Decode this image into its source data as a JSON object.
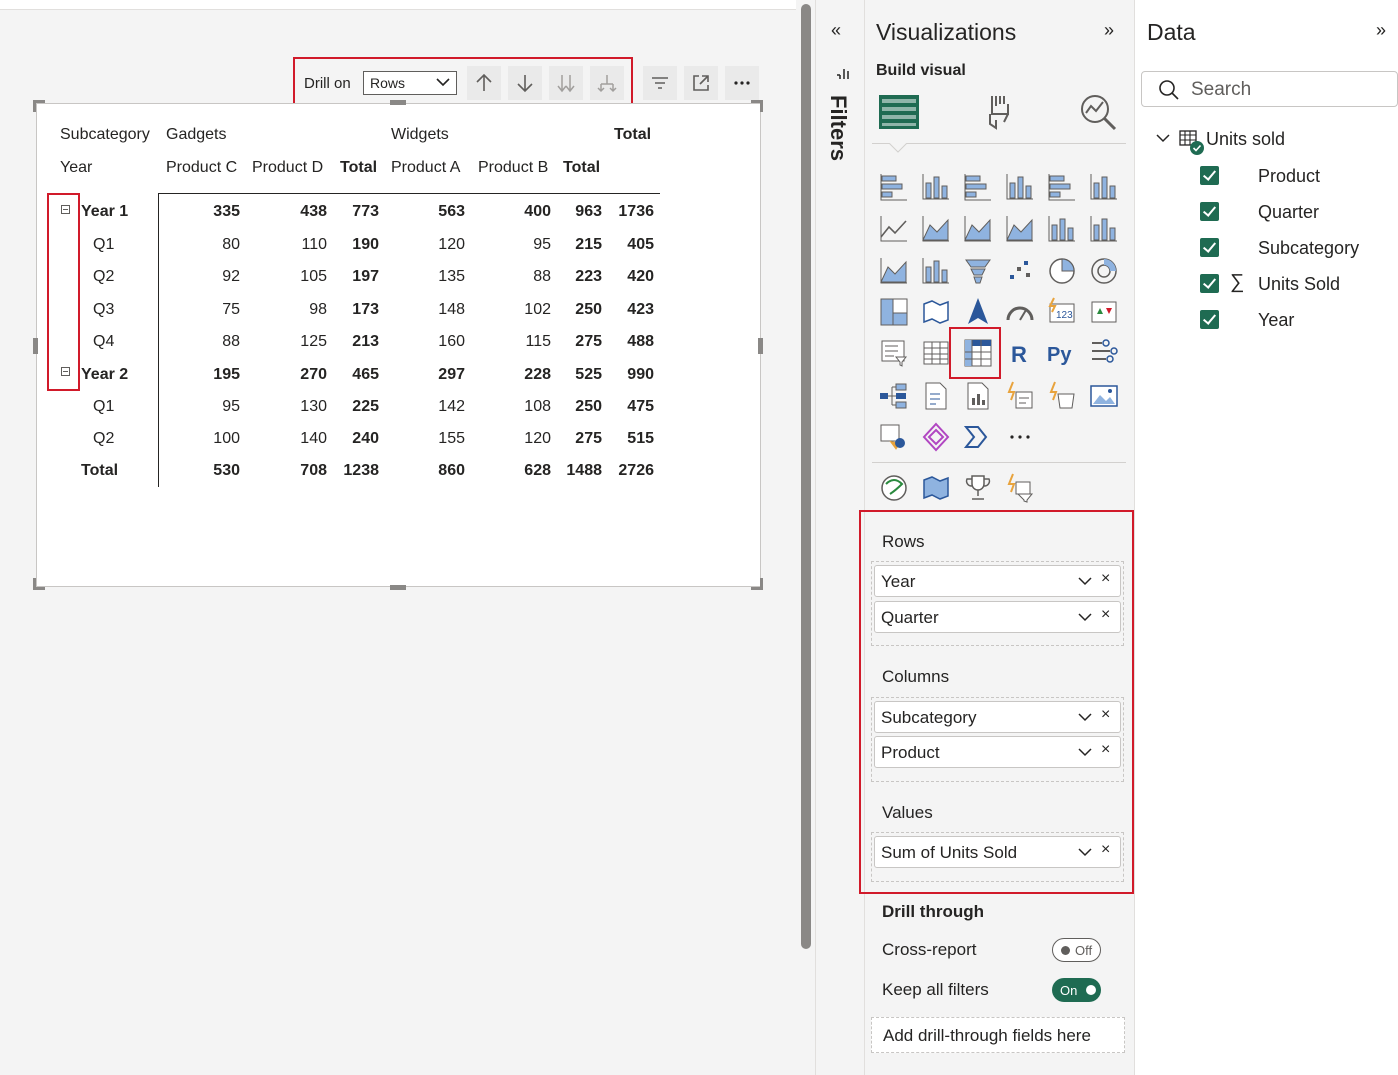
{
  "visual_header": {
    "drill_on_label": "Drill on",
    "drill_on_value": "Rows"
  },
  "matrix": {
    "col_header_1": "Subcategory",
    "col_header_2": "Year",
    "subcategories": [
      "Gadgets",
      "Widgets",
      "Total"
    ],
    "products": [
      "Product C",
      "Product D",
      "Total",
      "Product A",
      "Product B",
      "Total"
    ],
    "rows": [
      {
        "label": "Year 1",
        "level": 0,
        "values": [
          "335",
          "438",
          "773",
          "563",
          "400",
          "963",
          "1736"
        ]
      },
      {
        "label": "Q1",
        "level": 1,
        "values": [
          "80",
          "110",
          "190",
          "120",
          "95",
          "215",
          "405"
        ]
      },
      {
        "label": "Q2",
        "level": 1,
        "values": [
          "92",
          "105",
          "197",
          "135",
          "88",
          "223",
          "420"
        ]
      },
      {
        "label": "Q3",
        "level": 1,
        "values": [
          "75",
          "98",
          "173",
          "148",
          "102",
          "250",
          "423"
        ]
      },
      {
        "label": "Q4",
        "level": 1,
        "values": [
          "88",
          "125",
          "213",
          "160",
          "115",
          "275",
          "488"
        ]
      },
      {
        "label": "Year 2",
        "level": 0,
        "values": [
          "195",
          "270",
          "465",
          "297",
          "228",
          "525",
          "990"
        ]
      },
      {
        "label": "Q1",
        "level": 1,
        "values": [
          "95",
          "130",
          "225",
          "142",
          "108",
          "250",
          "475"
        ]
      },
      {
        "label": "Q2",
        "level": 1,
        "values": [
          "100",
          "140",
          "240",
          "155",
          "120",
          "275",
          "515"
        ]
      },
      {
        "label": "Total",
        "level": 0,
        "values": [
          "530",
          "708",
          "1238",
          "860",
          "628",
          "1488",
          "2726"
        ]
      }
    ]
  },
  "filters": {
    "label": "Filters",
    "collapse_glyph": "«"
  },
  "visualizations": {
    "title": "Visualizations",
    "expand_glyph": "»",
    "build_visual": "Build visual",
    "more_glyph": "···",
    "wells": {
      "rows_head": "Rows",
      "rows": [
        "Year",
        "Quarter"
      ],
      "columns_head": "Columns",
      "columns": [
        "Subcategory",
        "Product"
      ],
      "values_head": "Values",
      "values": [
        "Sum of Units Sold"
      ],
      "remove_glyph": "×"
    },
    "drill_through": {
      "title": "Drill through",
      "cross_report": "Cross-report",
      "cross_report_state": "Off",
      "keep_all_filters": "Keep all filters",
      "keep_all_filters_state": "On",
      "drop_placeholder": "Add drill-through fields here"
    }
  },
  "data_pane": {
    "title": "Data",
    "expand_glyph": "»",
    "search_placeholder": "Search",
    "table_name": "Units sold",
    "fields": [
      {
        "name": "Product",
        "checked": true,
        "sigma": ""
      },
      {
        "name": "Quarter",
        "checked": true,
        "sigma": ""
      },
      {
        "name": "Subcategory",
        "checked": true,
        "sigma": ""
      },
      {
        "name": "Units Sold",
        "checked": true,
        "sigma": "∑"
      },
      {
        "name": "Year",
        "checked": true,
        "sigma": ""
      }
    ]
  },
  "colors": {
    "accent": "#1f6b52",
    "highlight_box": "#d11a2a",
    "chart_blue": "#2b579a"
  }
}
